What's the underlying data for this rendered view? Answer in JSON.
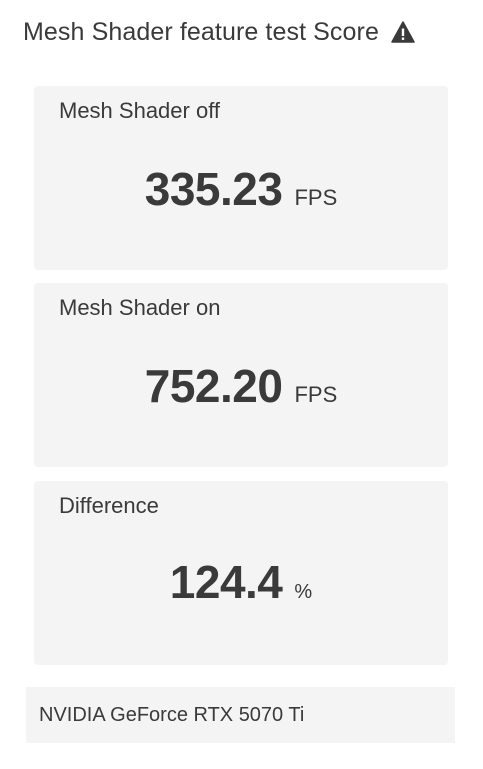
{
  "header": {
    "title": "Mesh Shader feature test Score",
    "icon": "warning-icon"
  },
  "results": [
    {
      "label": "Mesh Shader off",
      "value": "335.23",
      "unit": "FPS"
    },
    {
      "label": "Mesh Shader on",
      "value": "752.20",
      "unit": "FPS"
    },
    {
      "label": "Difference",
      "value": "124.4",
      "unit": "%"
    }
  ],
  "device": {
    "name": "NVIDIA GeForce RTX 5070 Ti"
  },
  "colors": {
    "text": "#3a3a3a",
    "card_background": "#f4f4f4",
    "page_background": "#ffffff"
  }
}
